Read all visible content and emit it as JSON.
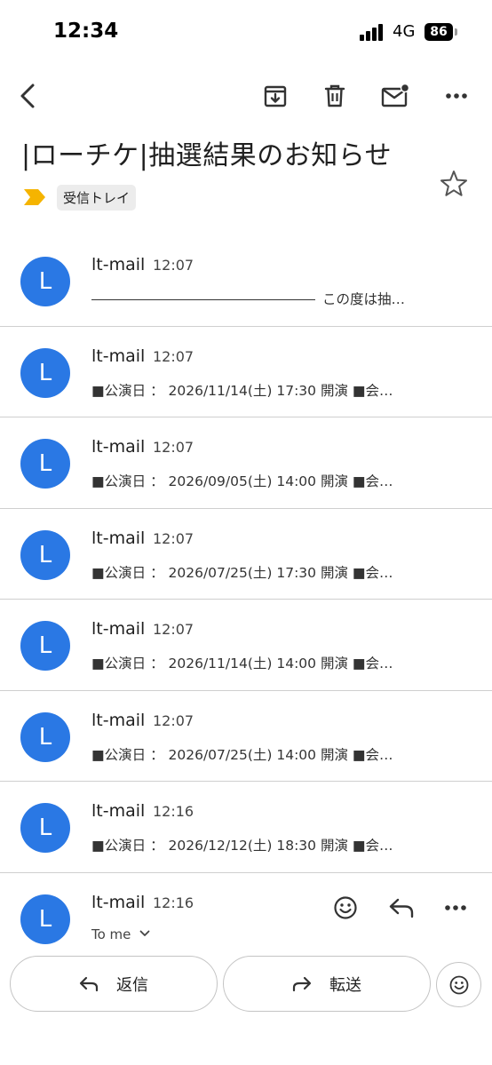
{
  "status_bar": {
    "time": "12:34",
    "network": "4G",
    "battery": "86"
  },
  "toolbar": {
    "icons": [
      "back-icon",
      "archive-icon",
      "delete-icon",
      "mark-unread-icon",
      "more-icon"
    ]
  },
  "email": {
    "subject": "|ローチケ|抽選結果のお知らせ",
    "label": "受信トレイ",
    "colors": {
      "avatar": "#2a78e4",
      "importance": "#f5b400"
    }
  },
  "messages": [
    {
      "avatar": "L",
      "sender": "lt-mail",
      "time": "12:07",
      "snippet": "この度は抽…"
    },
    {
      "avatar": "L",
      "sender": "lt-mail",
      "time": "12:07",
      "snippet": "■公演日 ： 2026/11/14(土) 17:30 開演 ■会…"
    },
    {
      "avatar": "L",
      "sender": "lt-mail",
      "time": "12:07",
      "snippet": "■公演日 ： 2026/09/05(土) 14:00 開演 ■会…"
    },
    {
      "avatar": "L",
      "sender": "lt-mail",
      "time": "12:07",
      "snippet": "■公演日 ： 2026/07/25(土) 17:30 開演 ■会…"
    },
    {
      "avatar": "L",
      "sender": "lt-mail",
      "time": "12:07",
      "snippet": "■公演日 ： 2026/11/14(土) 14:00 開演 ■会…"
    },
    {
      "avatar": "L",
      "sender": "lt-mail",
      "time": "12:07",
      "snippet": "■公演日 ： 2026/07/25(土) 14:00 開演 ■会…"
    },
    {
      "avatar": "L",
      "sender": "lt-mail",
      "time": "12:16",
      "snippet": "■公演日 ： 2026/12/12(土) 18:30 開演 ■会…"
    }
  ],
  "last_message": {
    "avatar": "L",
    "sender": "lt-mail",
    "time": "12:16",
    "recipient": "To me"
  },
  "actions": {
    "reply": "返信",
    "forward": "転送"
  }
}
